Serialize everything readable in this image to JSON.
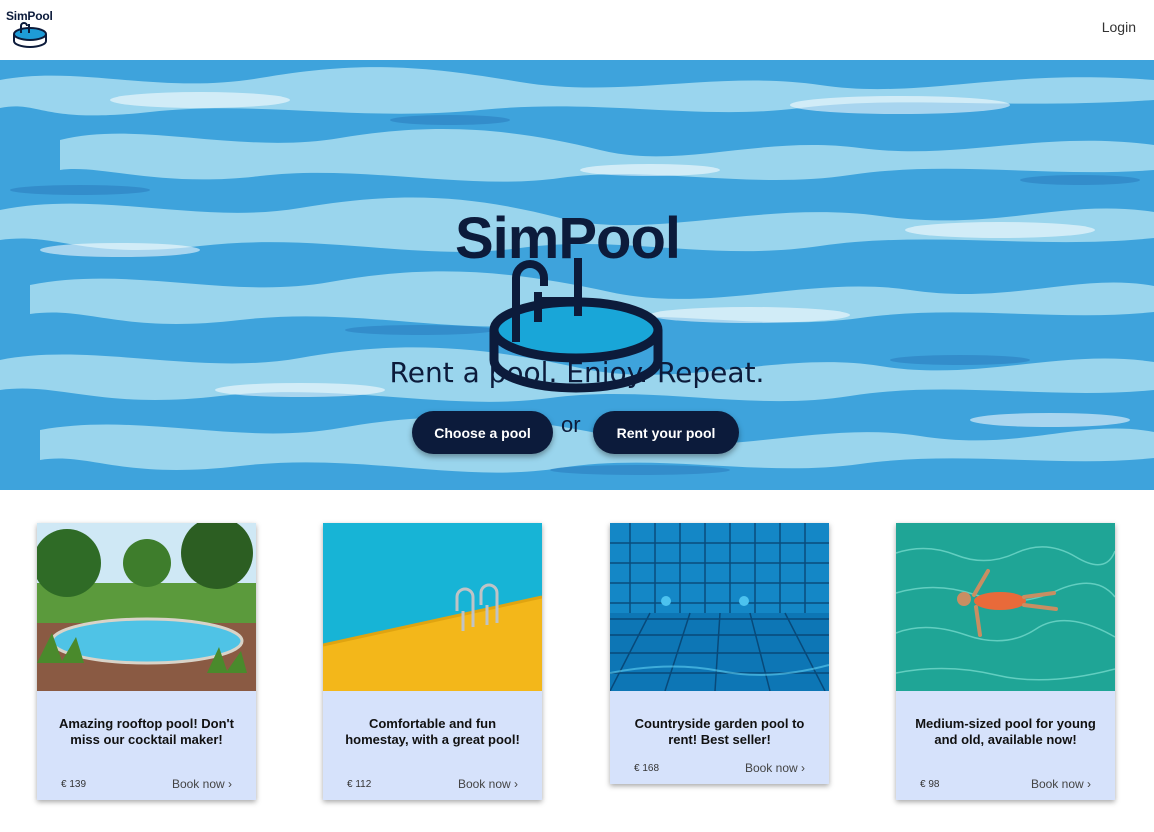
{
  "header": {
    "brand": "SimPool",
    "login_label": "Login"
  },
  "hero": {
    "logo_text": "SimPool",
    "tagline": "Rent a pool. Enjoy. Repeat.",
    "choose_label": "Choose a pool",
    "or_label": "or",
    "rent_label": "Rent your pool"
  },
  "cards": [
    {
      "title": "Amazing rooftop pool! Don't miss our cocktail maker!",
      "price": "€ 139",
      "book_label": "Book now"
    },
    {
      "title": "Comfortable and fun homestay, with a great pool!",
      "price": "€ 112",
      "book_label": "Book now"
    },
    {
      "title": "Countryside garden pool to rent! Best seller!",
      "price": "€ 168",
      "book_label": "Book now"
    },
    {
      "title": "Medium-sized pool for young and old, available now!",
      "price": "€ 98",
      "book_label": "Book now"
    }
  ],
  "colors": {
    "navy": "#0c1b3b",
    "card_bg": "#d6e2fb",
    "water_deep": "#3a9fd8",
    "water_light": "#a8dcef"
  }
}
